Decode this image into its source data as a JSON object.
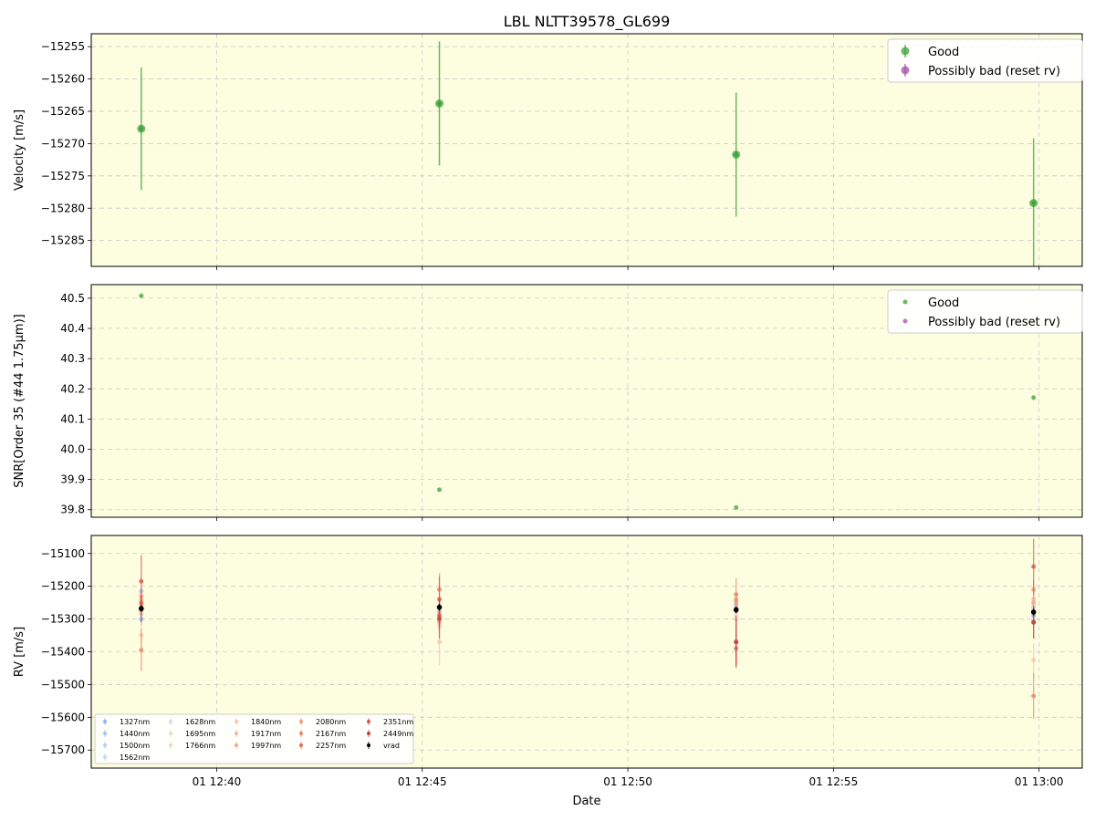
{
  "title": "LBL NLTT39578_GL699",
  "xlabel": "Date",
  "x_ticks": [
    "01 12:40",
    "01 12:45",
    "01 12:50",
    "01 12:55",
    "01 13:00"
  ],
  "legend": {
    "good": "Good",
    "bad": "Possibly bad (reset rv)"
  },
  "colors": {
    "panel_bg": "#fdfde0",
    "good": "#3aa23a",
    "bad": "#a64ca6",
    "grid": "#cccccc",
    "vrad": "#000000"
  },
  "chart_data": [
    {
      "type": "scatter",
      "panel": "velocity",
      "ylabel": "Velocity [m/s]",
      "ylim": [
        -15289,
        -15253
      ],
      "yticks": [
        -15255,
        -15260,
        -15265,
        -15270,
        -15275,
        -15280,
        -15285
      ],
      "grid": true,
      "legend_position": "top-right",
      "series": [
        {
          "name": "Good",
          "x": [
            "12:38:10",
            "12:45:25",
            "12:52:38",
            "12:59:52"
          ],
          "y": [
            -15267.7,
            -15263.8,
            -15271.7,
            -15279.2
          ],
          "yerr": [
            9.5,
            9.6,
            9.6,
            10.0
          ]
        },
        {
          "name": "Possibly bad (reset rv)",
          "x": [],
          "y": [],
          "yerr": []
        }
      ]
    },
    {
      "type": "scatter",
      "panel": "snr",
      "ylabel": "SNR[Order 35 (#44 1.75μm)]",
      "ylim": [
        39.775,
        40.545
      ],
      "yticks": [
        40.5,
        40.4,
        40.3,
        40.2,
        40.1,
        40.0,
        39.9,
        39.8
      ],
      "grid": true,
      "legend_position": "top-right",
      "series": [
        {
          "name": "Good",
          "x": [
            "12:38:10",
            "12:45:25",
            "12:52:38",
            "12:59:52"
          ],
          "y": [
            40.508,
            39.866,
            39.807,
            40.171
          ]
        },
        {
          "name": "Possibly bad (reset rv)",
          "x": [],
          "y": []
        }
      ]
    },
    {
      "type": "scatter",
      "panel": "rv",
      "ylabel": "RV [m/s]",
      "ylim": [
        -15755,
        -15045
      ],
      "yticks": [
        -15100,
        -15200,
        -15300,
        -15400,
        -15500,
        -15600,
        -15700
      ],
      "grid": true,
      "legend_position": "bottom-left",
      "x": [
        "12:38:10",
        "12:45:25",
        "12:52:38",
        "12:59:52"
      ],
      "series": [
        {
          "name": "1327nm",
          "color": "#8fb3f5",
          "y": [
            -15300,
            -15290,
            -15265,
            -15290
          ],
          "yerr": [
            20,
            20,
            20,
            20
          ]
        },
        {
          "name": "1440nm",
          "color": "#a3c2f7",
          "y": [
            -15215,
            -15265,
            -15255,
            -15265
          ],
          "yerr": [
            18,
            18,
            18,
            18
          ]
        },
        {
          "name": "1500nm",
          "color": "#b5cdf6",
          "y": [
            -15250,
            -15275,
            -15260,
            -15305
          ],
          "yerr": [
            15,
            15,
            15,
            15
          ]
        },
        {
          "name": "1562nm",
          "color": "#c6d6f2",
          "y": [
            -15285,
            -15280,
            -15270,
            -15280
          ],
          "yerr": [
            15,
            15,
            15,
            15
          ]
        },
        {
          "name": "1628nm",
          "color": "#d4dbec",
          "y": [
            -15270,
            -15285,
            -15275,
            -15270
          ],
          "yerr": [
            15,
            15,
            15,
            15
          ]
        },
        {
          "name": "1695nm",
          "color": "#e5dbd3",
          "y": [
            -15280,
            -15300,
            -15290,
            -15260
          ],
          "yerr": [
            15,
            15,
            15,
            15
          ]
        },
        {
          "name": "1766nm",
          "color": "#f2d4c3",
          "y": [
            -15260,
            -15320,
            -15280,
            -15250
          ],
          "yerr": [
            25,
            25,
            25,
            25
          ]
        },
        {
          "name": "1840nm",
          "color": "#f5c7ab",
          "y": [
            -15350,
            -15370,
            -15300,
            -15425
          ],
          "yerr": [
            40,
            70,
            30,
            50
          ]
        },
        {
          "name": "1917nm",
          "color": "#f4b99b",
          "y": [
            -15240,
            -15310,
            -15250,
            -15240
          ],
          "yerr": [
            25,
            30,
            25,
            30
          ]
        },
        {
          "name": "1997nm",
          "color": "#f2a98a",
          "y": [
            -15230,
            -15285,
            -15245,
            -15250
          ],
          "yerr": [
            25,
            30,
            25,
            30
          ]
        },
        {
          "name": "2080nm",
          "color": "#ef9878",
          "y": [
            -15255,
            -15295,
            -15240,
            -15210
          ],
          "yerr": [
            30,
            30,
            25,
            30
          ]
        },
        {
          "name": "2167nm",
          "color": "#ea8568",
          "y": [
            -15395,
            -15210,
            -15225,
            -15535
          ],
          "yerr": [
            65,
            50,
            50,
            70
          ]
        },
        {
          "name": "2257nm",
          "color": "#e0705a",
          "y": [
            -15250,
            -15290,
            -15390,
            -15310
          ],
          "yerr": [
            40,
            40,
            55,
            50
          ]
        },
        {
          "name": "2351nm",
          "color": "#d3564d",
          "y": [
            -15185,
            -15240,
            -15370,
            -15140
          ],
          "yerr": [
            80,
            70,
            80,
            85
          ]
        },
        {
          "name": "2449nm",
          "color": "#c43e44",
          "y": [
            -15270,
            -15300,
            -15370,
            -15310
          ],
          "yerr": [
            40,
            60,
            70,
            50
          ]
        },
        {
          "name": "vrad",
          "color": "#000000",
          "y": [
            -15268,
            -15264,
            -15272,
            -15279
          ],
          "yerr": [
            10,
            10,
            10,
            10
          ]
        }
      ]
    }
  ]
}
